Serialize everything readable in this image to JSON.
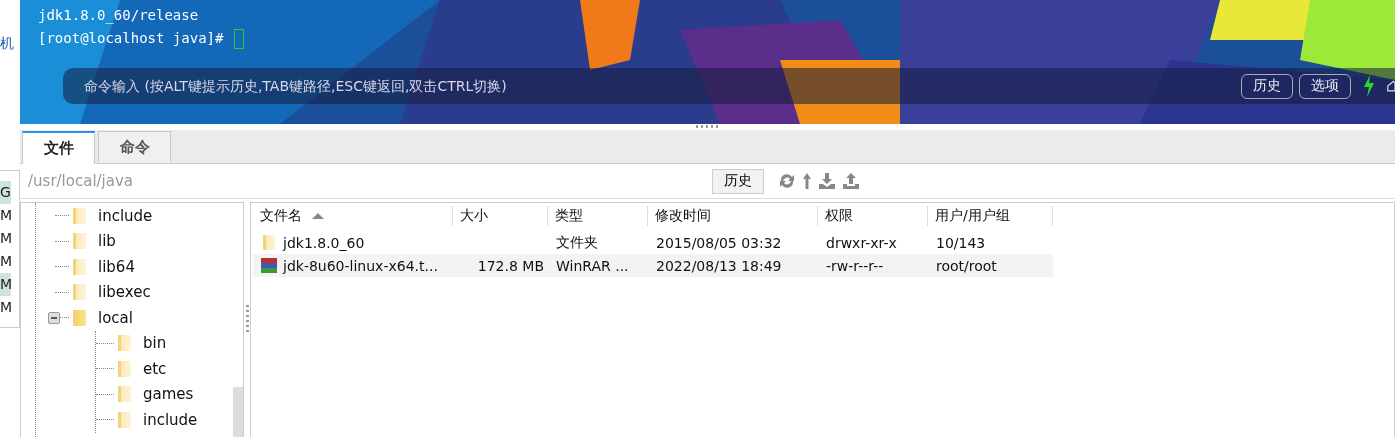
{
  "side_window": {
    "title_fragment": "机",
    "rows": [
      {
        "text": "G",
        "selected": true
      },
      {
        "text": "M",
        "selected": false
      },
      {
        "text": "M",
        "selected": false
      },
      {
        "text": "M",
        "selected": false
      },
      {
        "text": "M",
        "selected": true
      },
      {
        "text": "M",
        "selected": false
      }
    ]
  },
  "terminal": {
    "lines": [
      "jdk1.8.0_60/release",
      "[root@localhost java]# "
    ],
    "command_input": {
      "placeholder": "命令输入 (按ALT键提示历史,TAB键路径,ESC键返回,双击CTRL切换)"
    },
    "buttons": [
      "历史",
      "选项"
    ]
  },
  "tabs": [
    {
      "label": "文件",
      "selected": true
    },
    {
      "label": "命令",
      "selected": false
    }
  ],
  "path_bar": {
    "value": "/usr/local/java",
    "history_button": "历史"
  },
  "tree": {
    "items": [
      {
        "label": "include",
        "expanded": false
      },
      {
        "label": "lib",
        "expanded": false
      },
      {
        "label": "lib64",
        "expanded": false
      },
      {
        "label": "libexec",
        "expanded": false
      },
      {
        "label": "local",
        "expanded": true,
        "children": [
          {
            "label": "bin",
            "expanded": false
          },
          {
            "label": "etc",
            "expanded": false
          },
          {
            "label": "games",
            "expanded": false
          },
          {
            "label": "include",
            "expanded": false
          }
        ]
      }
    ]
  },
  "file_table": {
    "columns": [
      {
        "label": "文件名",
        "sorted_ascending": true
      },
      {
        "label": "大小",
        "sorted_ascending": false
      },
      {
        "label": "类型",
        "sorted_ascending": false
      },
      {
        "label": "修改时间",
        "sorted_ascending": false
      },
      {
        "label": "权限",
        "sorted_ascending": false
      },
      {
        "label": "用户/用户组",
        "sorted_ascending": false
      }
    ],
    "rows": [
      {
        "kind": "folder",
        "selected": false,
        "cells": [
          "jdk1.8.0_60",
          "",
          "文件夹",
          "2015/08/05 03:32",
          "drwxr-xr-x",
          "10/143"
        ]
      },
      {
        "kind": "archive",
        "selected": true,
        "cells": [
          "jdk-8u60-linux-x64.t...",
          "172.8 MB",
          "WinRAR ...",
          "2022/08/13 18:49",
          "-rw-r--r--",
          "root/root"
        ]
      }
    ]
  }
}
